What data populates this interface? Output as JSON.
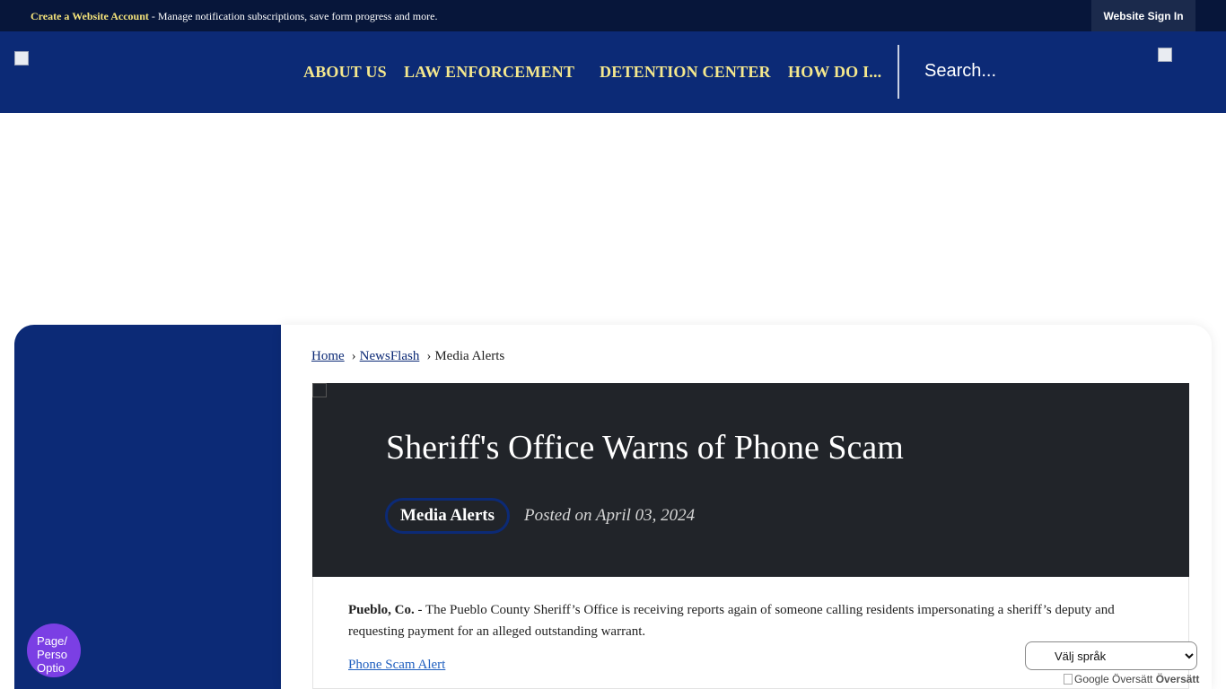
{
  "topbar": {
    "create_account": "Create a Website Account",
    "message": " - Manage notification subscriptions, save form progress and more.",
    "sign_in": "Website Sign In"
  },
  "nav": {
    "items": [
      "ABOUT US",
      "LAW ENFORCEMENT",
      "DETENTION CENTER",
      "HOW DO I..."
    ],
    "search_placeholder": "Search..."
  },
  "breadcrumb": {
    "home": "Home",
    "newsflash": "NewsFlash",
    "current": "Media Alerts"
  },
  "article": {
    "title": "Sheriff's Office Warns of Phone Scam",
    "category": "Media Alerts",
    "posted": "Posted on April 03, 2024",
    "lead_bold": "Pueblo, Co.",
    "lead_text": " - The Pueblo County Sheriff’s Office is receiving reports again of someone calling residents impersonating a sheriff’s deputy and requesting payment for an alleged outstanding warrant.",
    "link": "Phone Scam Alert"
  },
  "page_options": {
    "alt_text": [
      "Page/",
      "Perso",
      "Optio"
    ]
  },
  "translate": {
    "select_label": "Välj språk",
    "powered_alt": "Google Översätt",
    "powered_word": "Översätt"
  },
  "colors": {
    "topbar": "#07163a",
    "header": "#0c2a76",
    "nav_text": "#f5e88d",
    "hero": "#212429",
    "accent_purple": "#7b3fe4"
  }
}
